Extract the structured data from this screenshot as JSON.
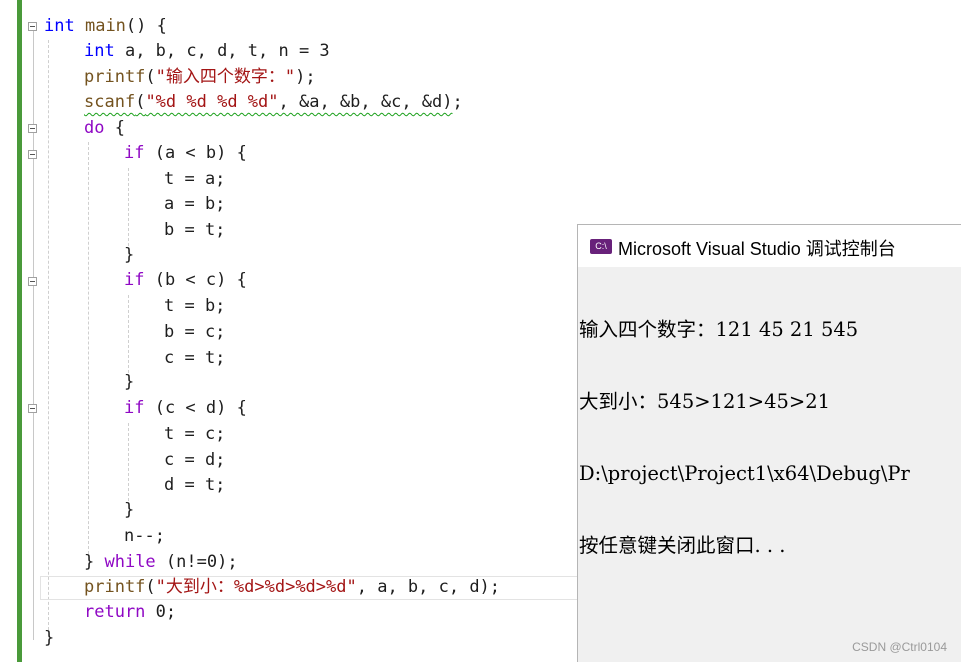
{
  "editor": {
    "lines": [
      [
        {
          "t": "int",
          "c": "kw"
        },
        {
          "t": " "
        },
        {
          "t": "main",
          "c": "fn"
        },
        {
          "t": "() {"
        }
      ],
      [
        {
          "t": "int",
          "c": "kw"
        },
        {
          "t": " a, b, c, d, t, n = 3"
        }
      ],
      [
        {
          "t": "printf",
          "c": "fn"
        },
        {
          "t": "("
        },
        {
          "t": "\"输入四个数字：\"",
          "c": "str"
        },
        {
          "t": ");"
        }
      ],
      [
        {
          "t": "scanf",
          "c": "fn squig"
        },
        {
          "t": "(",
          "c": "squig"
        },
        {
          "t": "\"%d %d %d %d\"",
          "c": "str squig"
        },
        {
          "t": ", &a, &b, &c, &d)",
          "c": "squig"
        },
        {
          "t": ";"
        }
      ],
      [
        {
          "t": "do",
          "c": "ctl"
        },
        {
          "t": " {"
        }
      ],
      [
        {
          "t": "if",
          "c": "ctl"
        },
        {
          "t": " (a < b) {"
        }
      ],
      [
        {
          "t": "t = a;"
        }
      ],
      [
        {
          "t": "a = b;"
        }
      ],
      [
        {
          "t": "b = t;"
        }
      ],
      [
        {
          "t": "}"
        }
      ],
      [
        {
          "t": "if",
          "c": "ctl"
        },
        {
          "t": " (b < c) {"
        }
      ],
      [
        {
          "t": "t = b;"
        }
      ],
      [
        {
          "t": "b = c;"
        }
      ],
      [
        {
          "t": "c = t;"
        }
      ],
      [
        {
          "t": "}"
        }
      ],
      [
        {
          "t": "if",
          "c": "ctl"
        },
        {
          "t": " (c < d) {"
        }
      ],
      [
        {
          "t": "t = c;"
        }
      ],
      [
        {
          "t": "c = d;"
        }
      ],
      [
        {
          "t": "d = t;"
        }
      ],
      [
        {
          "t": "}"
        }
      ],
      [
        {
          "t": "n--;"
        }
      ],
      [
        {
          "t": "} "
        },
        {
          "t": "while",
          "c": "ctl"
        },
        {
          "t": " (n!=0);"
        }
      ],
      [
        {
          "t": "printf",
          "c": "fn"
        },
        {
          "t": "("
        },
        {
          "t": "\"大到小：%d>%d>%d>%d\"",
          "c": "str"
        },
        {
          "t": ", a, b, c, d);"
        }
      ],
      [
        {
          "t": "return",
          "c": "ctl"
        },
        {
          "t": " 0;"
        }
      ],
      [
        {
          "t": "}"
        }
      ]
    ]
  },
  "console": {
    "title": "Microsoft Visual Studio 调试控制台",
    "icon_label": "C:\\",
    "output": [
      "输入四个数字：121 45 21 545",
      "大到小：545>121>45>21",
      "D:\\project\\Project1\\x64\\Debug\\Pr",
      "按任意键关闭此窗口. . ."
    ]
  },
  "watermark": "CSDN @Ctrl0104",
  "colors": {
    "keyword": "#0000ff",
    "control": "#8f08c4",
    "string": "#a31515",
    "function": "#74531f",
    "change_bar": "#4a9a3a"
  }
}
